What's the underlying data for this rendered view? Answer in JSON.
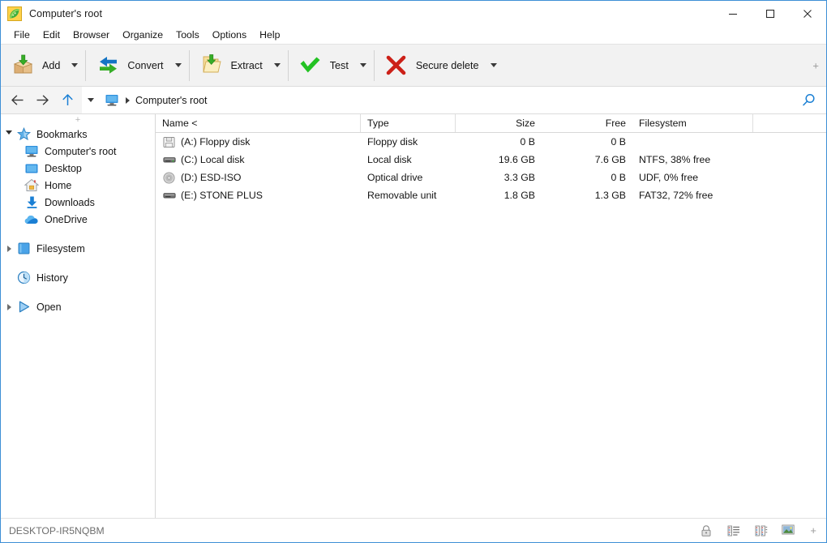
{
  "window": {
    "title": "Computer's root",
    "app_icon": "peazip-icon",
    "controls": {
      "minimize": "minimize-icon",
      "maximize": "maximize-icon",
      "close": "close-icon"
    },
    "border_color": "#3e8fd6"
  },
  "menu": {
    "items": [
      {
        "label": "File"
      },
      {
        "label": "Edit"
      },
      {
        "label": "Browser"
      },
      {
        "label": "Organize"
      },
      {
        "label": "Tools"
      },
      {
        "label": "Options"
      },
      {
        "label": "Help"
      }
    ]
  },
  "toolbar": {
    "buttons": [
      {
        "label": "Add",
        "icon": "add-box-icon",
        "has_dropdown": true
      },
      {
        "label": "Convert",
        "icon": "convert-arrows-icon",
        "has_dropdown": true
      },
      {
        "label": "Extract",
        "icon": "extract-folder-icon",
        "has_dropdown": true
      },
      {
        "label": "Test",
        "icon": "test-checkmark-icon",
        "has_dropdown": true
      },
      {
        "label": "Secure delete",
        "icon": "secure-delete-x-icon",
        "has_dropdown": true
      }
    ],
    "overflow_label": "+"
  },
  "addressbar": {
    "back": "back-arrow-icon",
    "forward": "forward-arrow-icon",
    "up": "up-arrow-icon",
    "history_caret": "chevron-down-icon",
    "root_icon": "computer-monitor-icon",
    "path": "Computer's root",
    "search": "search-icon"
  },
  "sidebar": {
    "add_label": "+",
    "groups": [
      {
        "label": "Bookmarks",
        "icon": "star-icon",
        "expanded": true,
        "children": [
          {
            "label": "Computer's root",
            "icon": "computer-monitor-icon"
          },
          {
            "label": "Desktop",
            "icon": "desktop-icon"
          },
          {
            "label": "Home",
            "icon": "home-icon"
          },
          {
            "label": "Downloads",
            "icon": "download-icon"
          },
          {
            "label": "OneDrive",
            "icon": "cloud-icon"
          }
        ]
      },
      {
        "label": "Filesystem",
        "icon": "folder-blue-icon",
        "expanded": false,
        "children": []
      },
      {
        "label": "History",
        "icon": "clock-icon",
        "expanded": null,
        "children": []
      },
      {
        "label": "Open",
        "icon": "play-triangle-icon",
        "expanded": false,
        "children": []
      }
    ]
  },
  "filelist": {
    "columns": [
      {
        "key": "name",
        "label": "Name <",
        "align": "left"
      },
      {
        "key": "type",
        "label": "Type",
        "align": "left"
      },
      {
        "key": "size",
        "label": "Size",
        "align": "right"
      },
      {
        "key": "free",
        "label": "Free",
        "align": "right"
      },
      {
        "key": "filesystem",
        "label": "Filesystem",
        "align": "left"
      }
    ],
    "rows": [
      {
        "icon": "floppy-disk-icon",
        "name": "(A:) Floppy disk",
        "type": "Floppy disk",
        "size": "0 B",
        "free": "0 B",
        "filesystem": ""
      },
      {
        "icon": "hard-disk-icon",
        "name": "(C:) Local disk",
        "type": "Local disk",
        "size": "19.6 GB",
        "free": "7.6 GB",
        "filesystem": "NTFS, 38% free"
      },
      {
        "icon": "optical-disc-icon",
        "name": "(D:) ESD-ISO",
        "type": "Optical drive",
        "size": "3.3 GB",
        "free": "0 B",
        "filesystem": "UDF, 0% free"
      },
      {
        "icon": "removable-drive-icon",
        "name": "(E:) STONE PLUS",
        "type": "Removable unit",
        "size": "1.8 GB",
        "free": "1.3 GB",
        "filesystem": "FAT32, 72% free"
      }
    ]
  },
  "statusbar": {
    "text": "DESKTOP-IR5NQBM",
    "icons": [
      {
        "name": "padlock-icon"
      },
      {
        "name": "list-view-icon"
      },
      {
        "name": "details-view-icon"
      },
      {
        "name": "thumbnail-view-icon"
      }
    ],
    "plus_label": "+"
  }
}
